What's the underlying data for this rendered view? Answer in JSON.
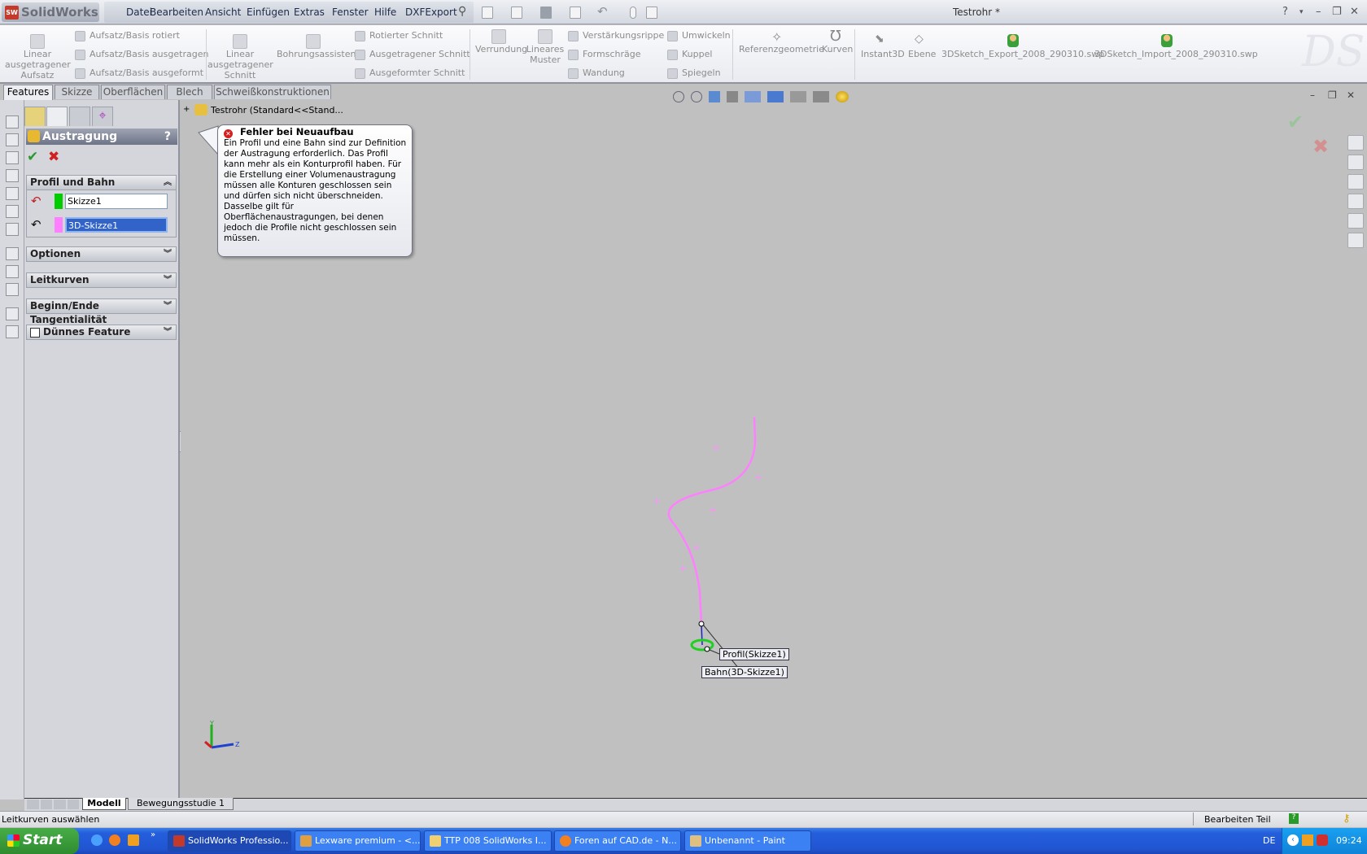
{
  "app": {
    "logo": "SolidWorks",
    "document_title": "Testrohr *"
  },
  "menu": [
    "Datei",
    "Bearbeiten",
    "Ansicht",
    "Einfügen",
    "Extras",
    "Fenster",
    "Hilfe",
    "DXFExport"
  ],
  "ribbon": {
    "linear_boss": [
      "Linear",
      "ausgetragener",
      "Aufsatz"
    ],
    "boss_items": [
      "Aufsatz/Basis rotiert",
      "Aufsatz/Basis ausgetragen",
      "Aufsatz/Basis ausgeformt"
    ],
    "linear_cut": [
      "Linear",
      "ausgetragener",
      "Schnitt"
    ],
    "hole_wizard": "Bohrungsassistent",
    "cut_items": [
      "Rotierter Schnitt",
      "Ausgetragener Schnitt",
      "Ausgeformter Schnitt"
    ],
    "fillet": "Verrundung",
    "pattern": [
      "Lineares",
      "Muster"
    ],
    "rib_items": [
      "Verstärkungsrippe",
      "Formschräge",
      "Wandung"
    ],
    "wrap_items": [
      "Umwickeln",
      "Kuppel",
      "Spiegeln"
    ],
    "refgeom": "Referenzgeometrie",
    "curves": "Kurven",
    "instant3d": "Instant3D",
    "plane": "Ebene",
    "macro_export": "3DSketch_Export_2008_290310.swp",
    "macro_import": "3DSketch_Import_2008_290310.swp"
  },
  "tabs": [
    "Features",
    "Skizze",
    "Oberflächen",
    "Blech",
    "Schweißkonstruktionen"
  ],
  "tree": {
    "root": "Testrohr  (Standard<<Stand..."
  },
  "pm": {
    "title": "Austragung",
    "help": "?",
    "section_profile": "Profil und Bahn",
    "profile_value": "Skizze1",
    "path_value": "3D-Skizze1",
    "sections": [
      "Optionen",
      "Leitkurven",
      "Beginn/Ende Tangentialität",
      "Dünnes Feature"
    ],
    "colors": {
      "profile": "#00cc00",
      "path": "#ff80ff"
    }
  },
  "tooltip": {
    "title": "Fehler bei Neuaufbau",
    "lines": [
      "Ein Profil und eine Bahn sind zur Definition",
      "der Austragung erforderlich. Das Profil",
      "kann mehr als ein Konturprofil haben. Für",
      "die Erstellung einer Volumenaustragung",
      "müssen alle Konturen geschlossen sein",
      "und dürfen sich nicht überschneiden.",
      "Dasselbe gilt für",
      "Oberflächenaustragungen, bei denen",
      "jedoch die Profile nicht geschlossen sein",
      "müssen."
    ]
  },
  "viewport": {
    "callout_profile": "Profil(Skizze1)",
    "callout_path": "Bahn(3D-Skizze1)",
    "triad": {
      "y": "Y",
      "z": "Z"
    }
  },
  "bottom_tabs": [
    "Modell",
    "Bewegungsstudie 1"
  ],
  "status": {
    "message": "Leitkurven auswählen",
    "mode": "Bearbeiten Teil"
  },
  "taskbar": {
    "start": "Start",
    "buttons": [
      "SolidWorks Professio...",
      "Lexware premium - <...",
      "TTP 008 SolidWorks I...",
      "Foren auf CAD.de - N...",
      "Unbenannt - Paint"
    ],
    "lang": "DE",
    "clock": "09:24"
  }
}
